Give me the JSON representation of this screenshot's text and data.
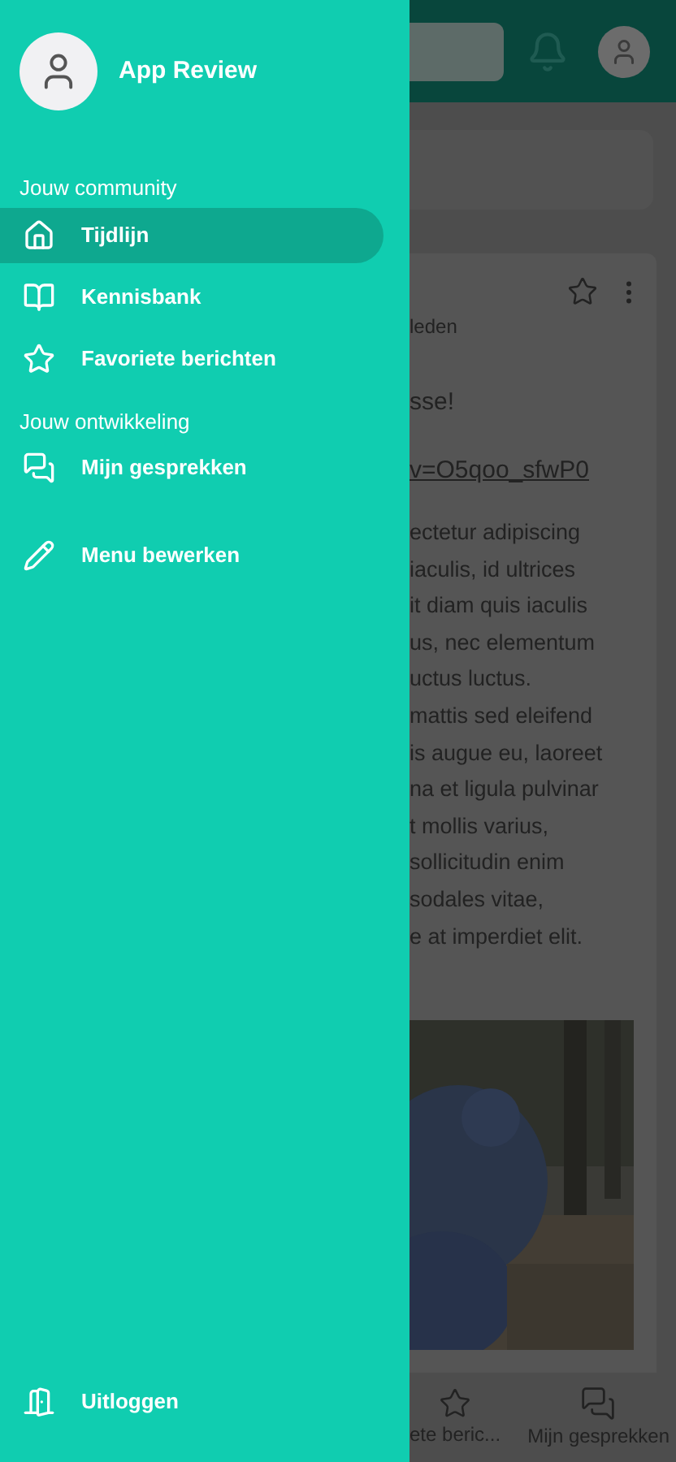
{
  "drawer": {
    "user": {
      "name": "App Review"
    },
    "sections": [
      {
        "heading": "Jouw community",
        "items": [
          {
            "label": "Tijdlijn",
            "selected": true
          },
          {
            "label": "Kennisbank",
            "selected": false
          },
          {
            "label": "Favoriete berichten",
            "selected": false
          }
        ]
      },
      {
        "heading": "Jouw ontwikkeling",
        "items": [
          {
            "label": "Mijn gesprekken",
            "selected": false
          }
        ]
      }
    ],
    "edit_item": {
      "label": "Menu bewerken"
    },
    "logout": {
      "label": "Uitloggen"
    }
  },
  "post": {
    "meta": "leden",
    "title": "sse!",
    "link": "v=O5qoo_sfwP0",
    "body_lines": [
      "ectetur adipiscing",
      "iaculis, id ultrices",
      "it diam quis iaculis",
      "us, nec elementum",
      "uctus luctus.",
      "mattis sed eleifend",
      "is augue eu, laoreet",
      "na et ligula pulvinar",
      "t mollis varius,",
      "sollicitudin enim",
      "sodales vitae,",
      "e at imperdiet elit."
    ]
  },
  "bottom_nav": [
    {
      "label": "ete beric..."
    },
    {
      "label": "Mijn gesprekken"
    }
  ]
}
